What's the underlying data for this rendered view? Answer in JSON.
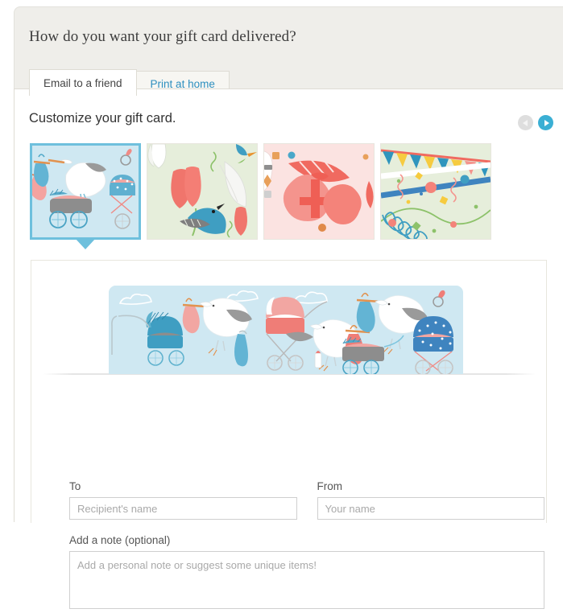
{
  "header": {
    "title": "How do you want your gift card delivered?"
  },
  "tabs": [
    {
      "label": "Email to a friend",
      "active": true
    },
    {
      "label": "Print at home",
      "active": false
    }
  ],
  "customize": {
    "section_title": "Customize your gift card.",
    "prev_icon": "triangle-left-icon",
    "next_icon": "triangle-right-icon",
    "prev_enabled": false,
    "next_enabled": true
  },
  "thumbnails": [
    {
      "name": "stork-baby-design",
      "selected": true
    },
    {
      "name": "tulips-bird-design",
      "selected": false
    },
    {
      "name": "hearts-valentine-design",
      "selected": false
    },
    {
      "name": "party-confetti-design",
      "selected": false
    }
  ],
  "preview": {
    "design_name": "stork-baby-design"
  },
  "form": {
    "to_label": "To",
    "to_value": "",
    "to_placeholder": "Recipient's name",
    "from_label": "From",
    "from_value": "",
    "from_placeholder": "Your name",
    "note_label": "Add a note (optional)",
    "note_value": "",
    "note_placeholder": "Add a personal note or suggest some unique items!"
  },
  "colors": {
    "accent_blue": "#3aafd4",
    "selected_border": "#6ec0dd",
    "link_blue": "#2d8fbf",
    "panel_beige": "#efeeea"
  }
}
